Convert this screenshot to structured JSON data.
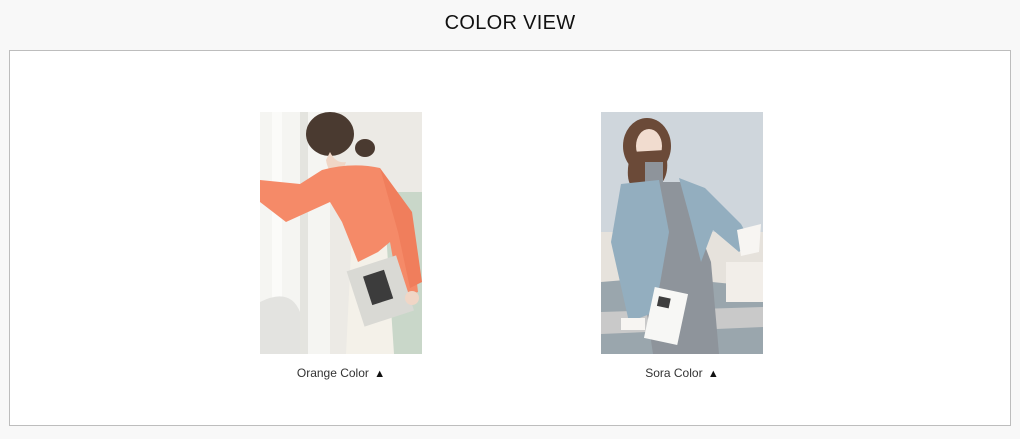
{
  "title": "COLOR VIEW",
  "items": [
    {
      "label": "Orange Color",
      "arrow": "▲",
      "image_alt": "Woman wearing an orange cardigan holding a magazine",
      "accent": "#f58a68"
    },
    {
      "label": "Sora Color",
      "arrow": "▲",
      "image_alt": "Woman wearing a sky blue cardigan over a gray dress holding a book",
      "accent": "#93aebf"
    }
  ]
}
